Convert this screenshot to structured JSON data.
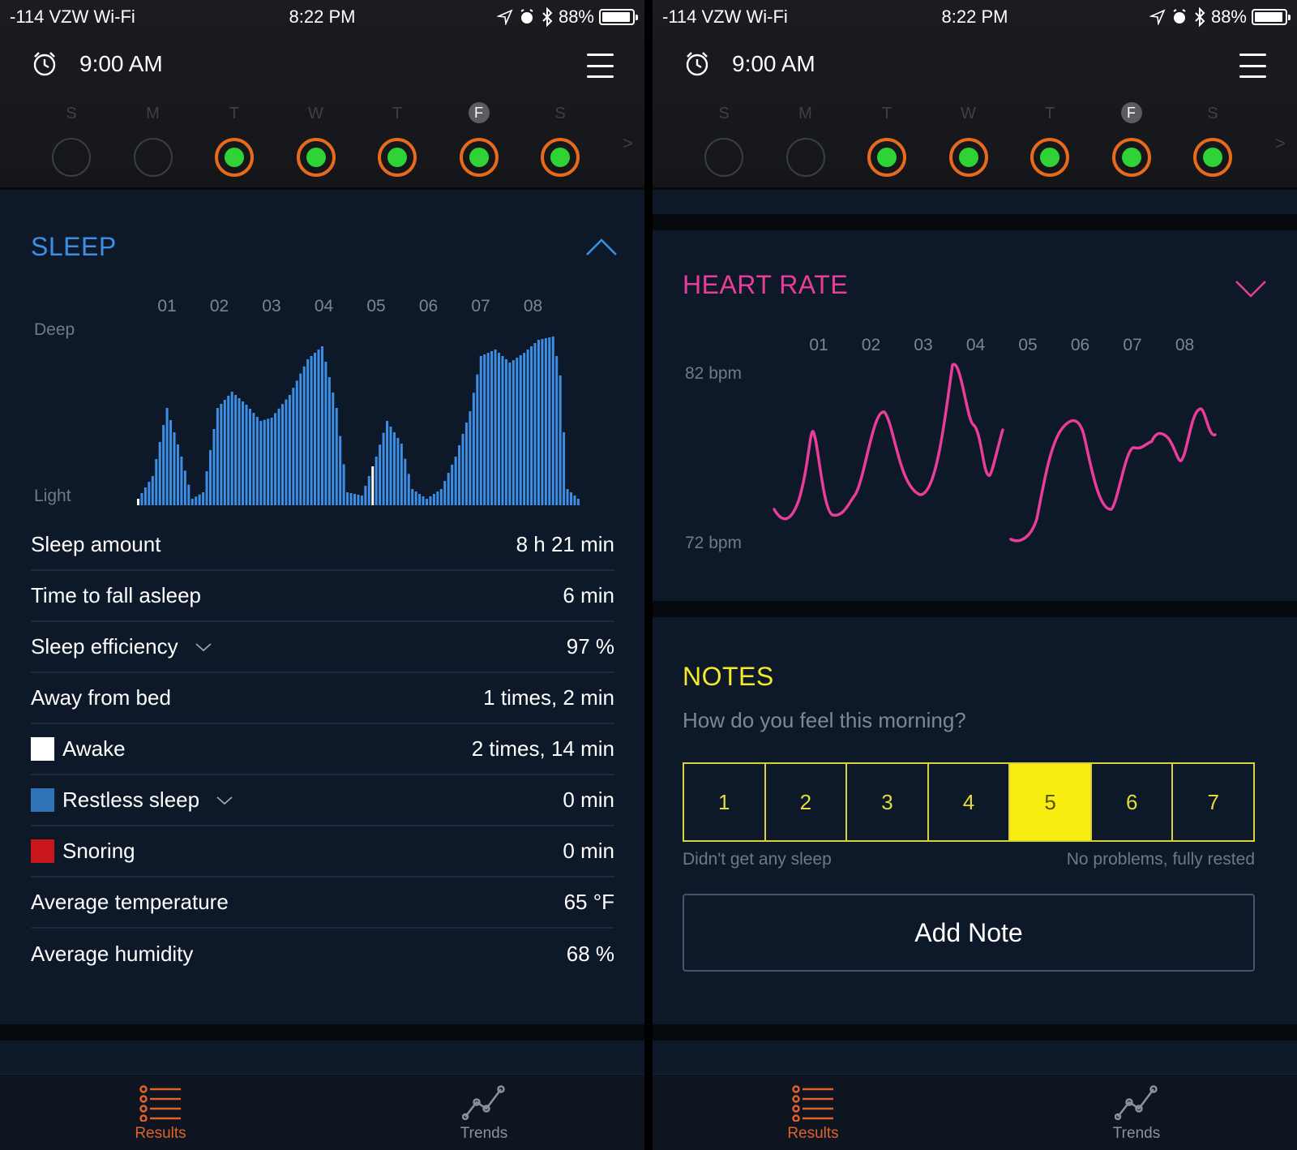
{
  "status": {
    "carrier": "-114 VZW Wi-Fi",
    "time": "8:22 PM",
    "battery": "88%"
  },
  "header": {
    "alarm_time": "9:00 AM"
  },
  "week": {
    "days": [
      "S",
      "M",
      "T",
      "W",
      "T",
      "F",
      "S"
    ],
    "selected_index": 5,
    "completed": [
      false,
      false,
      true,
      true,
      true,
      true,
      true
    ]
  },
  "sleep": {
    "title": "SLEEP",
    "hours": [
      "01",
      "02",
      "03",
      "04",
      "05",
      "06",
      "07",
      "08"
    ],
    "y_top": "Deep",
    "y_bottom": "Light",
    "stats": [
      {
        "label": "Sleep amount",
        "value": "8 h 21 min",
        "swatch": "",
        "dropdown": false
      },
      {
        "label": "Time to fall asleep",
        "value": "6 min",
        "swatch": "",
        "dropdown": false
      },
      {
        "label": "Sleep efficiency",
        "value": "97 %",
        "swatch": "",
        "dropdown": true
      },
      {
        "label": "Away from bed",
        "value": "1 times, 2 min",
        "swatch": "",
        "dropdown": false
      },
      {
        "label": "Awake",
        "value": "2 times, 14 min",
        "swatch": "#ffffff",
        "dropdown": false
      },
      {
        "label": "Restless sleep",
        "value": "0 min",
        "swatch": "#2f73b8",
        "dropdown": true
      },
      {
        "label": "Snoring",
        "value": "0 min",
        "swatch": "#c8161c",
        "dropdown": false
      },
      {
        "label": "Average temperature",
        "value": "65 °F",
        "swatch": "",
        "dropdown": false
      },
      {
        "label": "Average humidity",
        "value": "68 %",
        "swatch": "",
        "dropdown": false
      }
    ]
  },
  "heart_rate": {
    "title": "HEART RATE",
    "hours": [
      "01",
      "02",
      "03",
      "04",
      "05",
      "06",
      "07",
      "08"
    ],
    "y_top": "82 bpm",
    "y_bottom": "72 bpm"
  },
  "notes": {
    "title": "NOTES",
    "question": "How do you feel this morning?",
    "options": [
      "1",
      "2",
      "3",
      "4",
      "5",
      "6",
      "7"
    ],
    "selected": "5",
    "low_label": "Didn't get any sleep",
    "high_label": "No problems, fully rested",
    "add_button": "Add Note"
  },
  "tabs": {
    "results": "Results",
    "trends": "Trends"
  },
  "colors": {
    "sleep_accent": "#3d8fe6",
    "heart_accent": "#ea3c9a",
    "notes_accent": "#f4ea26",
    "ring": "#e86a1c",
    "ring_fill": "#2fd335",
    "tab_active": "#e0622a"
  }
}
